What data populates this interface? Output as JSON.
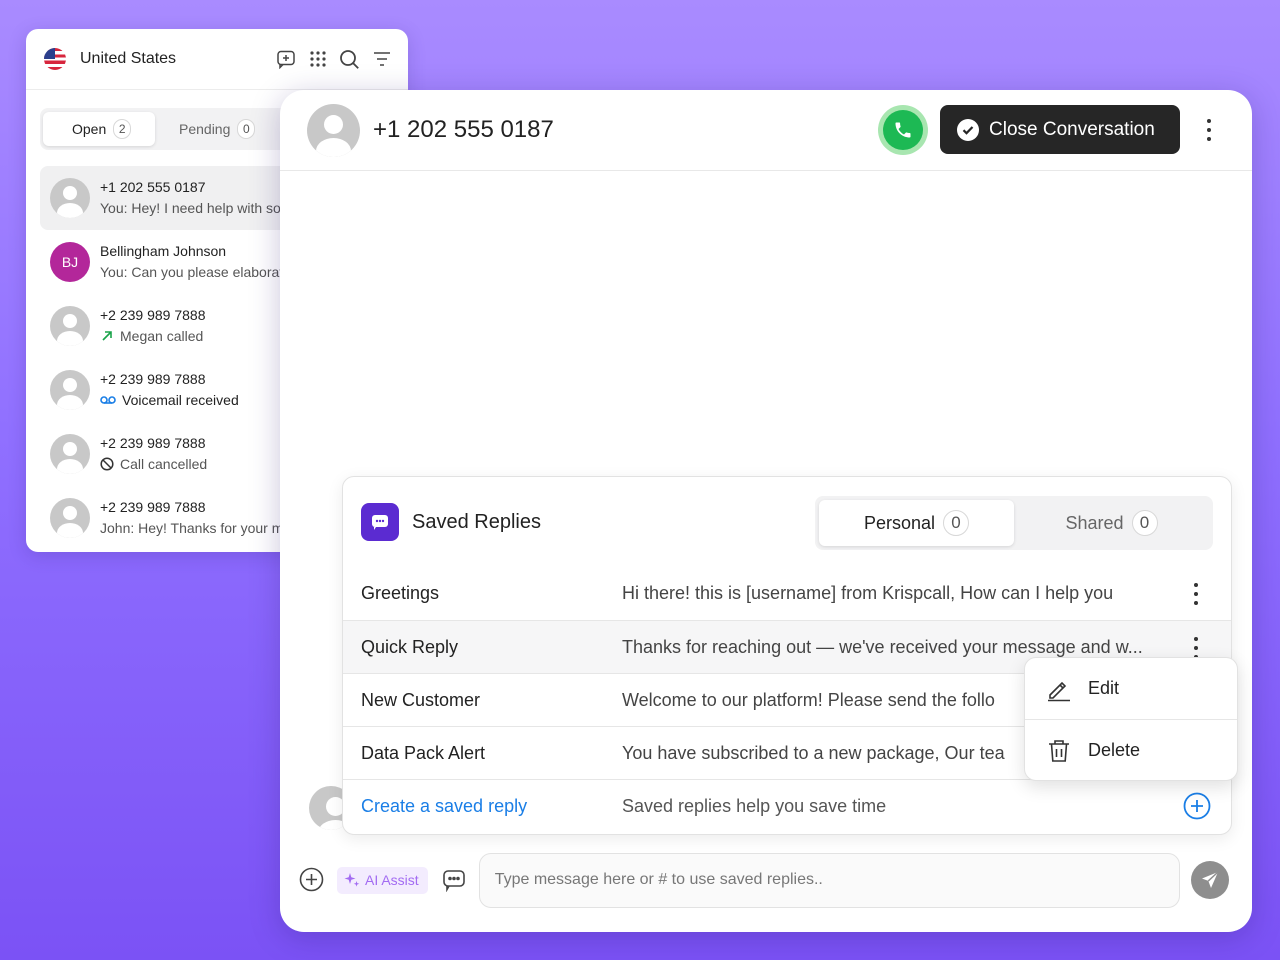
{
  "left_panel": {
    "country": "United States",
    "tabs": [
      {
        "label": "Open",
        "count": "2"
      },
      {
        "label": "Pending",
        "count": "0"
      }
    ],
    "conversations": [
      {
        "name": "+1 202 555 0187",
        "subtitle": "You: Hey! I need help with so"
      },
      {
        "name": "Bellingham Johnson",
        "initials": "BJ",
        "subtitle": "You: Can you please elaborat"
      },
      {
        "name": "+2 239 989 7888",
        "subtitle": "Megan called",
        "icon": "outgoing-call-arrow-icon"
      },
      {
        "name": "+2 239 989 7888",
        "subtitle": "Voicemail received",
        "icon": "voicemail-icon"
      },
      {
        "name": "+2 239 989 7888",
        "subtitle": "Call cancelled",
        "icon": "cancelled-icon"
      },
      {
        "name": "+2 239 989 7888",
        "subtitle": "John: Hey! Thanks for your m"
      }
    ]
  },
  "main": {
    "phone": "+1 202 555 0187",
    "close_label": "Close Conversation"
  },
  "saved_replies": {
    "title": "Saved Replies",
    "tabs": [
      {
        "label": "Personal",
        "count": "0"
      },
      {
        "label": "Shared",
        "count": "0"
      }
    ],
    "rows": [
      {
        "name": "Greetings",
        "text": "Hi there! this is [username] from Krispcall, How can I help you"
      },
      {
        "name": "Quick Reply",
        "text": "Thanks for reaching out — we've received your message and w..."
      },
      {
        "name": "New Customer",
        "text": "Welcome to our platform! Please send the follo"
      },
      {
        "name": "Data Pack Alert",
        "text": "You have subscribed to a new package, Our tea"
      }
    ],
    "create": {
      "label": "Create a saved reply",
      "text": "Saved replies help you save time"
    }
  },
  "context_menu": {
    "edit": "Edit",
    "delete": "Delete"
  },
  "composer": {
    "ai_label": "AI Assist",
    "placeholder": "Type message here or # to use saved replies.."
  },
  "colors": {
    "background": "#9070ff",
    "call_green": "#1db954",
    "link_blue": "#1a7ee6",
    "brand_purple": "#5b2bd1",
    "ai_purple": "#a36cf2"
  }
}
